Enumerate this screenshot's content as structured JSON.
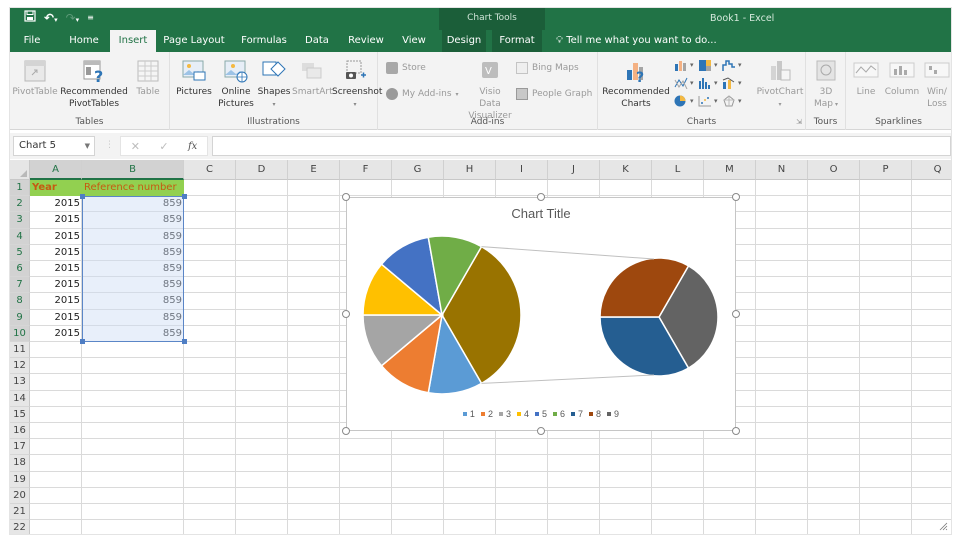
{
  "titlebar": {
    "qat": {
      "save_icon": "save-icon",
      "undo_icon": "undo-icon",
      "redo_icon": "redo-icon",
      "customize_icon": "customize-qat-icon"
    },
    "context_tools_label": "Chart Tools",
    "app_title": "Book1 - Excel"
  },
  "tabs": [
    {
      "label": "File"
    },
    {
      "label": "Home"
    },
    {
      "label": "Insert",
      "active": true
    },
    {
      "label": "Page Layout"
    },
    {
      "label": "Formulas"
    },
    {
      "label": "Data"
    },
    {
      "label": "Review"
    },
    {
      "label": "View"
    },
    {
      "label": "Design"
    },
    {
      "label": "Format"
    }
  ],
  "tell_me": "Tell me what you want to do...",
  "ribbon": {
    "groups": {
      "tables": {
        "label": "Tables",
        "pivot_table": "PivotTable",
        "recommended_pivot_1": "Recommended",
        "recommended_pivot_2": "PivotTables",
        "table": "Table"
      },
      "illustrations": {
        "label": "Illustrations",
        "pictures": "Pictures",
        "online_pictures_1": "Online",
        "online_pictures_2": "Pictures",
        "shapes": "Shapes",
        "smartart": "SmartArt",
        "screenshot": "Screenshot"
      },
      "addins": {
        "label": "Add-ins",
        "store": "Store",
        "my_addins": "My Add-ins",
        "visio_1": "Visio Data",
        "visio_2": "Visualizer",
        "bing_maps": "Bing Maps",
        "people_graph": "People Graph"
      },
      "charts": {
        "label": "Charts",
        "recommended_1": "Recommended",
        "recommended_2": "Charts",
        "pivot_chart": "PivotChart"
      },
      "tours": {
        "label": "Tours",
        "map_1": "3D",
        "map_2": "Map"
      },
      "sparklines": {
        "label": "Sparklines",
        "line": "Line",
        "column": "Column",
        "winloss_1": "Win/",
        "winloss_2": "Loss"
      }
    }
  },
  "formula_bar": {
    "name_box": "Chart 5",
    "cancel": "✕",
    "enter": "✓",
    "fx": "fx",
    "value": ""
  },
  "sheet": {
    "columns": [
      "A",
      "B",
      "C",
      "D",
      "E",
      "F",
      "G",
      "H",
      "I",
      "J",
      "K",
      "L",
      "M",
      "N",
      "O",
      "P",
      "Q"
    ],
    "rows": [
      "1",
      "2",
      "3",
      "4",
      "5",
      "6",
      "7",
      "8",
      "9",
      "10",
      "11",
      "12",
      "13",
      "14",
      "15",
      "16",
      "17",
      "18",
      "19",
      "20",
      "21",
      "22"
    ],
    "header": {
      "a1": "Year",
      "b1": "Reference number"
    },
    "data": [
      {
        "year": "2015",
        "ref": "859"
      },
      {
        "year": "2015",
        "ref": "859"
      },
      {
        "year": "2015",
        "ref": "859"
      },
      {
        "year": "2015",
        "ref": "859"
      },
      {
        "year": "2015",
        "ref": "859"
      },
      {
        "year": "2015",
        "ref": "859"
      },
      {
        "year": "2015",
        "ref": "859"
      },
      {
        "year": "2015",
        "ref": "859"
      },
      {
        "year": "2015",
        "ref": "859"
      }
    ]
  },
  "chart_data": {
    "type": "pie",
    "subtype": "pie-of-pie",
    "title": "Chart Title",
    "categories": [
      "1",
      "2",
      "3",
      "4",
      "5",
      "6",
      "7",
      "8",
      "9"
    ],
    "values": [
      859,
      859,
      859,
      859,
      859,
      859,
      859,
      859,
      859
    ],
    "colors": [
      "#5b9bd5",
      "#ed7d31",
      "#a5a5a5",
      "#ffc000",
      "#4472c4",
      "#70ad47",
      "#255e91",
      "#9e480e",
      "#636363"
    ],
    "primary_slices": [
      "1",
      "2",
      "3",
      "4",
      "5",
      "6"
    ],
    "secondary_slices": [
      "7",
      "8",
      "9"
    ],
    "other_slice_color": "#997300",
    "legend_position": "bottom"
  }
}
